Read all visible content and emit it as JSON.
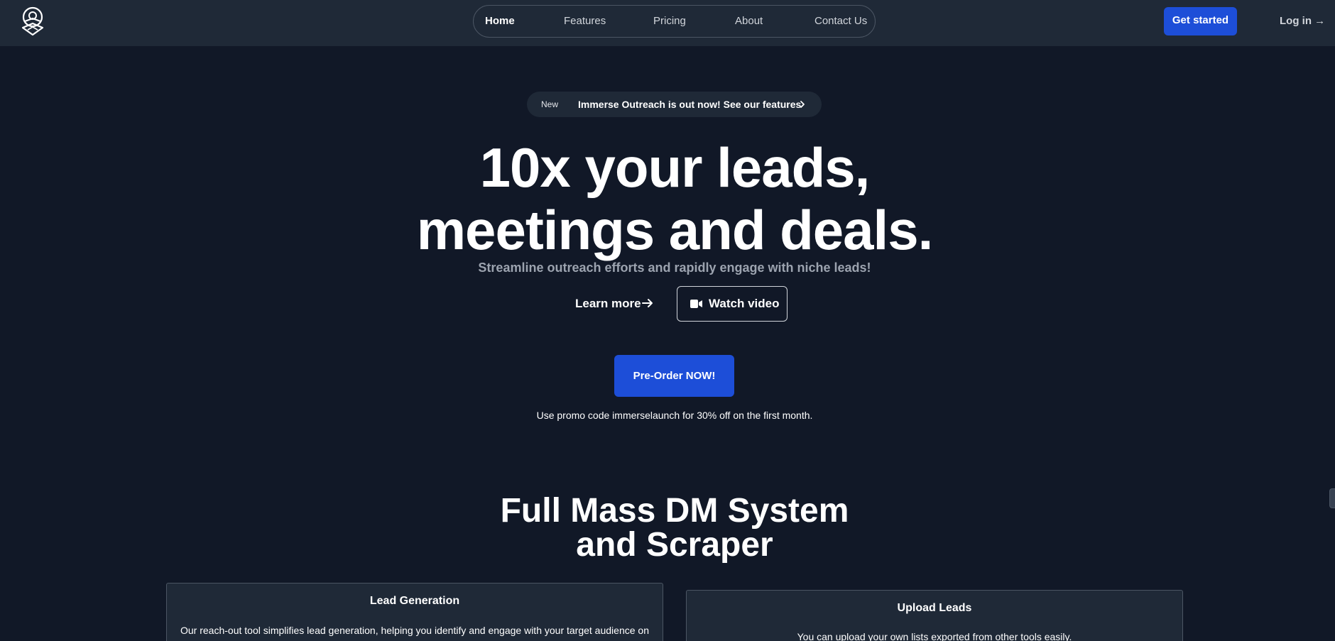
{
  "header": {
    "logo_icon": "aperture-logo-icon",
    "nav": [
      {
        "label": "Home",
        "active": true
      },
      {
        "label": "Features",
        "active": false
      },
      {
        "label": "Pricing",
        "active": false
      },
      {
        "label": "About",
        "active": false
      },
      {
        "label": "Contact Us",
        "active": false
      }
    ],
    "get_started": "Get started",
    "login": "Log in →"
  },
  "announcement": {
    "badge": "New",
    "text": "Immerse Outreach is out now! See our features",
    "icon": "chevron-right-icon"
  },
  "hero": {
    "title_line1": "10x your leads,",
    "title_line2": "meetings and deals.",
    "subtitle": "Streamline outreach efforts and rapidly engage with niche leads!",
    "learn_more": "Learn more",
    "watch_video": "Watch video",
    "preorder": "Pre-Order NOW!",
    "promo": "Use promo code immerselaunch for 30% off on the first month."
  },
  "section": {
    "title_line1": "Full Mass DM System",
    "title_line2": "and Scraper"
  },
  "cards": [
    {
      "title": "Lead Generation",
      "text": "Our reach-out tool simplifies lead generation, helping you identify and engage with your target audience on"
    },
    {
      "title": "Upload Leads",
      "text": "You can upload your own lists exported from other tools easily."
    }
  ],
  "colors": {
    "background": "#111827",
    "header": "#1f2937",
    "accent": "#1d4ed8",
    "muted_text": "#9ca3af"
  }
}
